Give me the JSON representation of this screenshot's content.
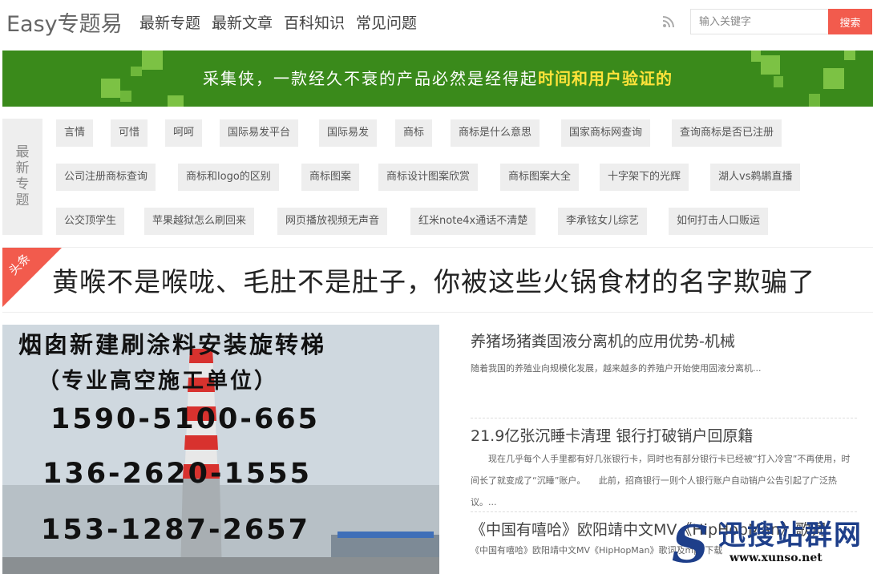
{
  "header": {
    "logo": "Easy专题易",
    "nav": [
      "最新专题",
      "最新文章",
      "百科知识",
      "常见问题"
    ],
    "search_placeholder": "输入关键字",
    "search_button": "搜索"
  },
  "banner": {
    "text": "采集侠，一款经久不衰的产品必然是经得起",
    "highlight": "时间和用户验证的"
  },
  "topics": {
    "label": [
      "最",
      "新",
      "专",
      "题"
    ],
    "tags": [
      "言情",
      "可惜",
      "呵呵",
      "国际易发平台",
      "国际易发",
      "商标",
      "商标是什么意思",
      "国家商标网查询",
      "查询商标是否已注册",
      "公司注册商标查询",
      "商标和logo的区别",
      "商标图案",
      "商标设计图案欣赏",
      "商标图案大全",
      "十字架下的光辉",
      "湖人vs鹈鹕直播",
      "公交顶学生",
      "苹果越狱怎么刷回来",
      "网页播放视频无声音",
      "红米note4x通话不清楚",
      "李承铉女儿综艺",
      "如何打击人口贩运"
    ]
  },
  "headline": {
    "badge": "头条",
    "title": "黄喉不是喉咙、毛肚不是肚子，你被这些火锅食材的名字欺骗了"
  },
  "feature": {
    "lines": [
      "烟囱新建刷涂料安装旋转梯",
      "（专业高空施工单位）",
      "1590-5100-665",
      "136-2620-1555",
      "153-1287-2657"
    ]
  },
  "articles": [
    {
      "title": "养猪场猪粪固液分离机的应用优势-机械",
      "desc": "随着我国的养殖业向规模化发展，越来越多的养殖户开始使用固液分离机..."
    },
    {
      "title": "21.9亿张沉睡卡清理 银行打破销户回原籍",
      "desc": "　　现在几乎每个人手里都有好几张银行卡，同时也有部分银行卡已经被“打入冷宫”不再使用，时间长了就变成了“沉睡”账户。　　此前，招商银行一则个人银行账户自动销户公告引起了广泛热议。..."
    },
    {
      "title": "《中国有嘻哈》欧阳靖中文MV《HipHopMan》歌词",
      "desc": "《中国有嘻哈》欧阳靖中文MV《HipHopMan》歌词及mp3下载"
    }
  ],
  "watermark": {
    "text": "迅搜站群网",
    "url": "www.xunso.net"
  },
  "colors": {
    "brand_green": "#3a8a1b",
    "accent_red": "#f25b4d",
    "highlight_yellow": "#ffe33a"
  }
}
